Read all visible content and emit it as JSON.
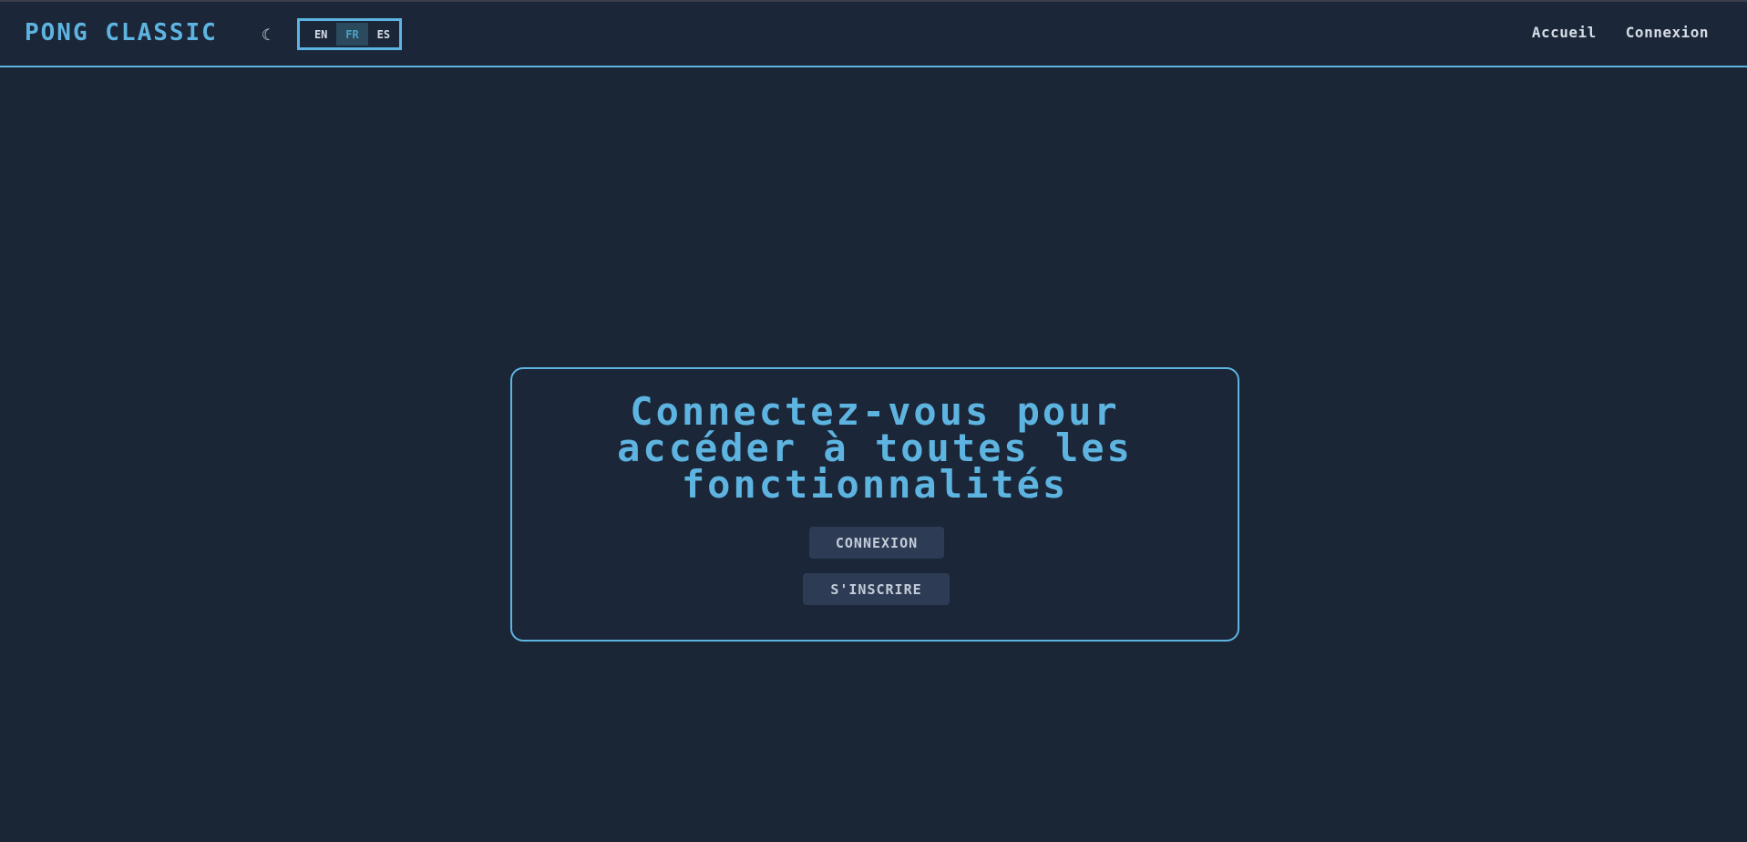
{
  "header": {
    "logo": "PONG CLASSIC",
    "theme_toggle_icon": "☾",
    "languages": [
      {
        "code": "EN",
        "active": false
      },
      {
        "code": "FR",
        "active": true
      },
      {
        "code": "ES",
        "active": false
      }
    ],
    "nav": {
      "home": "Accueil",
      "login": "Connexion"
    }
  },
  "main": {
    "prompt": "Connectez-vous pour accéder à toutes les fonctionnalités",
    "login_button": "CONNEXION",
    "signup_button": "S'INSCRIRE"
  },
  "colors": {
    "background": "#1a2535",
    "accent": "#5eb4e0",
    "button_bg": "#2e3b54",
    "text": "#d7dde6"
  }
}
